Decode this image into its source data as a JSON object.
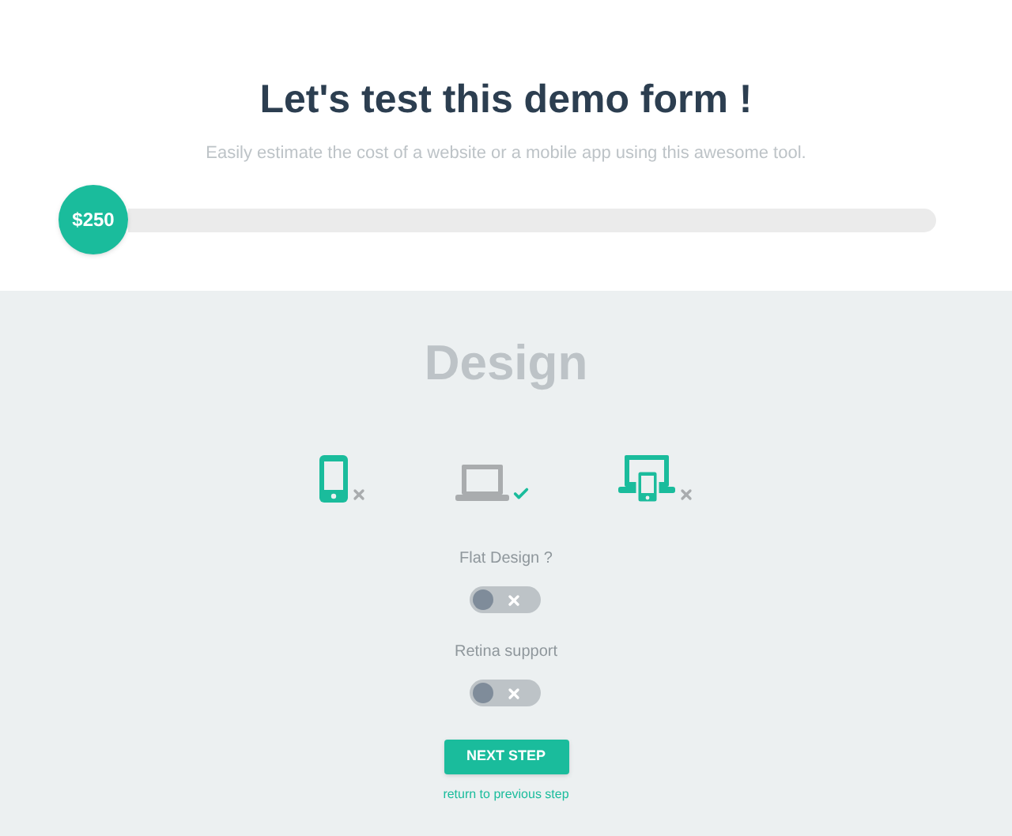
{
  "header": {
    "title": "Let's test this demo form !",
    "subtitle": "Easily estimate the cost of a website or a mobile app using this awesome tool."
  },
  "price_slider": {
    "reading": "$250",
    "level": 0
  },
  "section": {
    "title": "Design",
    "devices": [
      {
        "kind": "phone",
        "selected": false
      },
      {
        "kind": "laptop",
        "selected": true
      },
      {
        "kind": "both",
        "selected": false
      }
    ],
    "options": [
      {
        "label": "Flat Design ?",
        "on": false
      },
      {
        "label": "Retina support",
        "on": false
      }
    ],
    "next_button": "NEXT STEP",
    "back_link": "return to previous step"
  }
}
